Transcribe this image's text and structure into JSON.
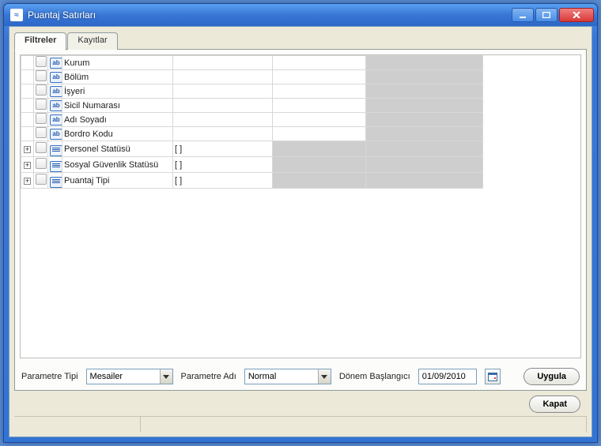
{
  "title": "Puantaj Satırları",
  "tabs": [
    {
      "label": "Filtreler",
      "active": true
    },
    {
      "label": "Kayıtlar",
      "active": false
    }
  ],
  "rows": [
    {
      "type": "text",
      "label": "Kurum",
      "v1": "",
      "v2": "",
      "v3": "",
      "disabled_v1": false,
      "disabled_v2": false,
      "disabled_v3": true
    },
    {
      "type": "text",
      "label": "Bölüm",
      "v1": "",
      "v2": "",
      "v3": "",
      "disabled_v1": false,
      "disabled_v2": false,
      "disabled_v3": true
    },
    {
      "type": "text",
      "label": "İşyeri",
      "v1": "",
      "v2": "",
      "v3": "",
      "disabled_v1": false,
      "disabled_v2": false,
      "disabled_v3": true
    },
    {
      "type": "text",
      "label": "Sicil Numarası",
      "v1": "",
      "v2": "",
      "v3": "",
      "disabled_v1": false,
      "disabled_v2": false,
      "disabled_v3": true
    },
    {
      "type": "text",
      "label": "Adı Soyadı",
      "v1": "",
      "v2": "",
      "v3": "",
      "disabled_v1": false,
      "disabled_v2": false,
      "disabled_v3": true
    },
    {
      "type": "text",
      "label": "Bordro Kodu",
      "v1": "",
      "v2": "",
      "v3": "",
      "disabled_v1": false,
      "disabled_v2": false,
      "disabled_v3": true
    },
    {
      "type": "list",
      "label": "Personel Statüsü",
      "v1": "[ ]",
      "v2": "",
      "v3": "",
      "disabled_v1": false,
      "disabled_v2": true,
      "disabled_v3": true
    },
    {
      "type": "list",
      "label": "Sosyal Güvenlik Statüsü",
      "v1": "[ ]",
      "v2": "",
      "v3": "",
      "disabled_v1": false,
      "disabled_v2": true,
      "disabled_v3": true
    },
    {
      "type": "list",
      "label": "Puantaj Tipi",
      "v1": "[ ]",
      "v2": "",
      "v3": "",
      "disabled_v1": false,
      "disabled_v2": true,
      "disabled_v3": true
    }
  ],
  "bottom": {
    "param_type_label": "Parametre Tipi",
    "param_type_value": "Mesailer",
    "param_name_label": "Parametre Adı",
    "param_name_value": "Normal",
    "period_label": "Dönem Başlangıcı",
    "period_value": "01/09/2010",
    "apply": "Uygula"
  },
  "footer": {
    "close": "Kapat"
  },
  "icons": {
    "ab": "ab"
  }
}
